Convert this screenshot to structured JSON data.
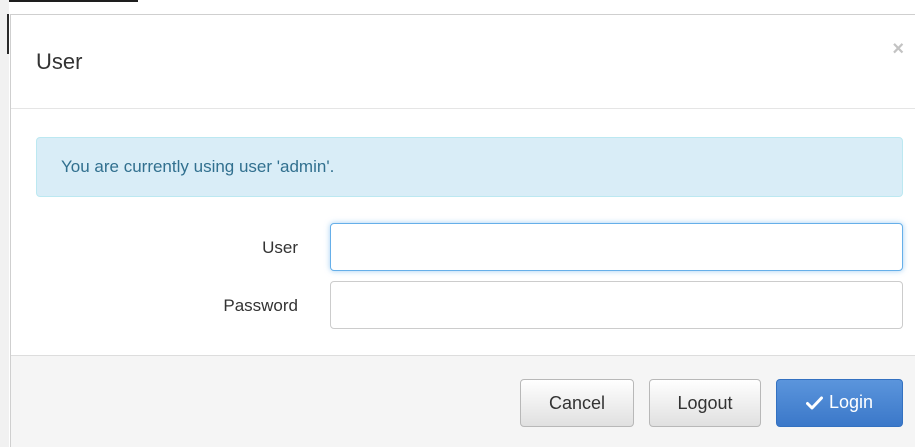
{
  "dialog": {
    "title": "User",
    "close_label": "×"
  },
  "alert": {
    "message": "You are currently using user 'admin'."
  },
  "form": {
    "user_label": "User",
    "user_value": "",
    "password_label": "Password",
    "password_value": ""
  },
  "footer": {
    "cancel_label": "Cancel",
    "logout_label": "Logout",
    "login_label": "Login",
    "login_icon": "check-icon"
  },
  "colors": {
    "alert_bg": "#d9edf7",
    "alert_text": "#31708f",
    "primary": "#428bca",
    "focus_ring": "#66afe9"
  }
}
